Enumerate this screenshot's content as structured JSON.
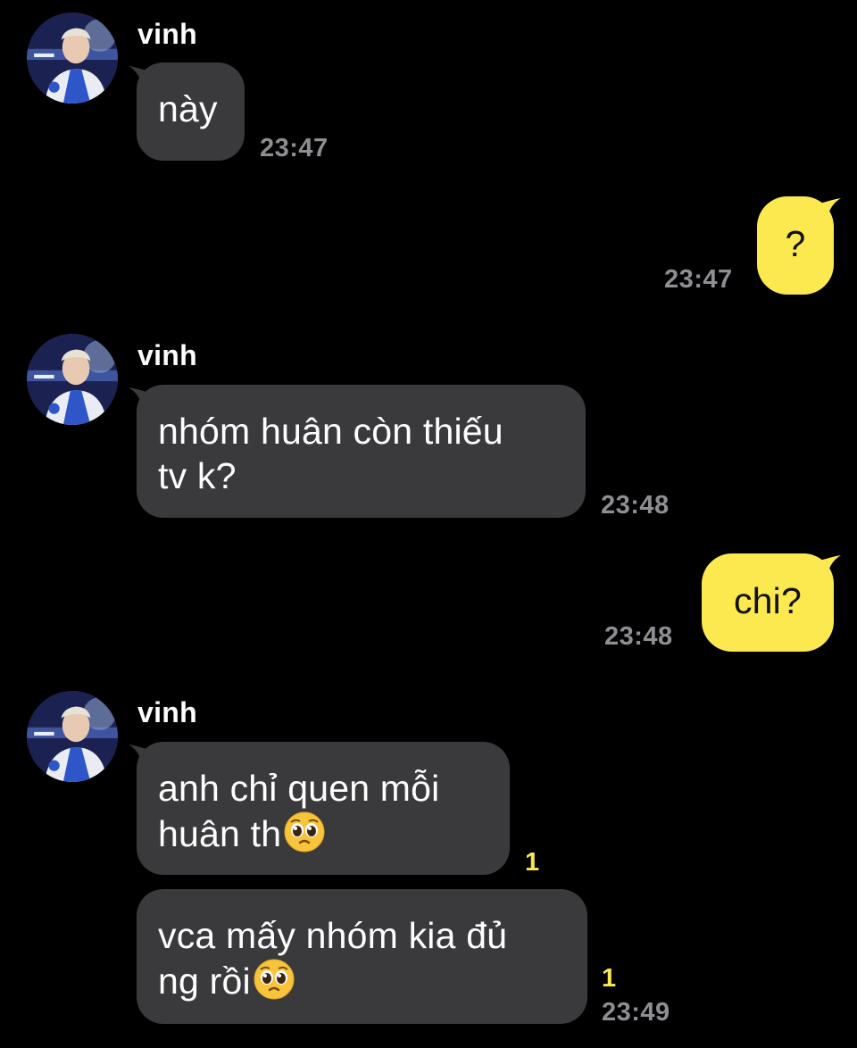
{
  "contact": {
    "name": "vinh"
  },
  "messages": [
    {
      "from": "vinh",
      "text": "này",
      "time": "23:47"
    },
    {
      "from": "me",
      "text": "?",
      "time": "23:47"
    },
    {
      "from": "vinh",
      "line1": "nhóm huân còn thiếu",
      "line2": "tv k?",
      "time": "23:48"
    },
    {
      "from": "me",
      "text": "chi?",
      "time": "23:48"
    },
    {
      "from": "vinh",
      "line1": "anh chỉ quen mỗi",
      "line2": "huân th",
      "emoji": "pleading-face-emoji",
      "unread": "1"
    },
    {
      "from": "vinh",
      "line1": "vca mấy nhóm kia đủ",
      "line2": "ng rồi",
      "emoji": "pleading-face-emoji",
      "unread": "1",
      "time": "23:49"
    }
  ],
  "colors": {
    "background": "#000000",
    "incoming_bubble": "#3a3a3c",
    "outgoing_bubble": "#fce94f",
    "timestamp": "#8e8e93",
    "unread_count": "#fce94f"
  }
}
